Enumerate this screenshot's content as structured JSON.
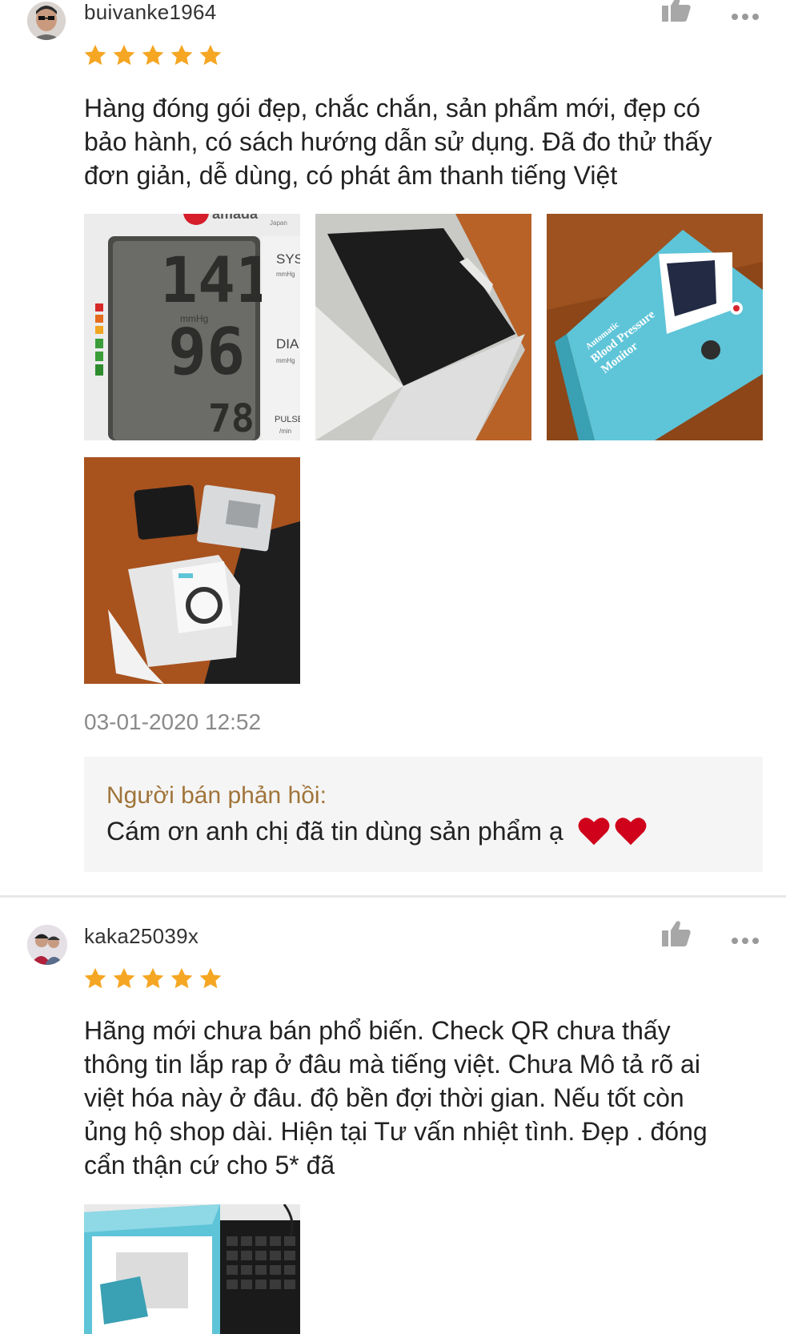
{
  "reviews": [
    {
      "username": "buivanke1964",
      "rating": 5,
      "text": [
        "Hàng đóng gói đẹp, chắc chắn, sản phẩm mới, đẹp có",
        "bảo hành, có sách hướng dẫn sử dụng. Đã đo thử thấy",
        "đơn giản, dễ dùng, có phát âm thanh tiếng Việt"
      ],
      "photos": {
        "p1": {
          "brand": "amada",
          "brand_sub": "Japan",
          "sys_label": "SYS",
          "sys_unit": "mmHg",
          "dia_label": "DIA",
          "dia_unit": "mmHg",
          "pulse_label": "PULSE",
          "pulse_unit": "/min",
          "mmhg": "mmHg",
          "sys_value": "141",
          "dia_value": "96",
          "pulse_value": "78"
        },
        "p3": {
          "box_text_1": "Automatic",
          "box_text_2": "Blood Pressure",
          "box_text_3": "Monitor"
        }
      },
      "timestamp": "03-01-2020 12:52",
      "seller_reply": {
        "label": "Người bán phản hồi:",
        "text": "Cám ơn anh chị đã tin dùng sản phẩm ạ"
      }
    },
    {
      "username": "kaka25039x",
      "rating": 5,
      "text": [
        "Hãng mới chưa bán phổ biến. Check QR chưa thấy",
        "thông tin lắp rap ở đâu mà tiếng việt. Chưa Mô tả rõ ai",
        "việt hóa này ở đâu. độ bền đợi thời gian. Nếu tốt còn",
        "ủng hộ shop dài. Hiện tại Tư vấn nhiệt tình. Đẹp . đóng",
        "cẩn thận cứ cho 5* đã"
      ]
    }
  ],
  "icons": {
    "like": "thumbs-up-icon",
    "more": "more-dots-icon",
    "star": "star-icon",
    "heart": "heart-icon"
  },
  "colors": {
    "star": "#f5a623",
    "reply_label": "#a0743a",
    "heart": "#d0021b"
  }
}
